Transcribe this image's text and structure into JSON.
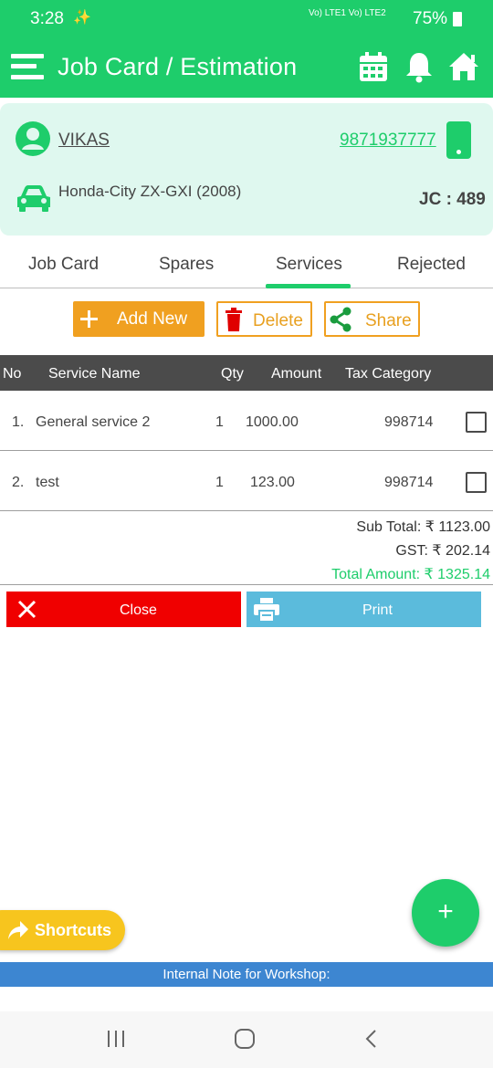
{
  "status_bar": {
    "time": "3:28",
    "network": "Vo) LTE1 Vo) LTE2",
    "battery": "75%"
  },
  "app_bar": {
    "title": "Job Card / Estimation"
  },
  "customer": {
    "name": "VIKAS",
    "phone": "9871937777",
    "vehicle": "Honda-City ZX-GXI (2008)",
    "job_card": "JC : 489"
  },
  "tabs": [
    {
      "label": "Job Card",
      "active": false
    },
    {
      "label": "Spares",
      "active": false
    },
    {
      "label": "Services",
      "active": true
    },
    {
      "label": "Rejected",
      "active": false
    }
  ],
  "actions": {
    "add_new": "Add New",
    "delete": "Delete",
    "share": "Share"
  },
  "table": {
    "columns": [
      "No",
      "Service Name",
      "Qty",
      "Amount",
      "Tax Category"
    ],
    "rows": [
      {
        "no": "1.",
        "name": "General service 2",
        "qty": "1",
        "amount": "1000.00",
        "tax": "998714",
        "checked": false
      },
      {
        "no": "2.",
        "name": "test",
        "qty": "1",
        "amount": "123.00",
        "tax": "998714",
        "checked": false
      }
    ]
  },
  "totals": {
    "sub_total": "Sub Total: ₹ 1123.00",
    "gst": "GST: ₹ 202.14",
    "total": "Total Amount: ₹ 1325.14"
  },
  "buttons": {
    "close": "Close",
    "print": "Print"
  },
  "fab": {
    "label": "+"
  },
  "shortcuts": {
    "label": "Shortcuts"
  },
  "note": {
    "label": "Internal Note for Workshop:"
  },
  "colors": {
    "primary": "#1ecd6b",
    "accent": "#f0a020",
    "danger": "#f00000",
    "print": "#5bbbdc",
    "note": "#3d86d1",
    "shortcut": "#f7c51e"
  },
  "icons": {
    "menu": "menu-icon",
    "calendar": "calendar-icon",
    "bell": "bell-icon",
    "home": "home-icon",
    "user": "user-icon",
    "phone": "phone-icon",
    "car": "car-icon",
    "plus": "plus-icon",
    "trash": "trash-icon",
    "share": "share-icon",
    "close": "close-icon",
    "printer": "printer-icon",
    "forward": "forward-arrow-icon"
  }
}
